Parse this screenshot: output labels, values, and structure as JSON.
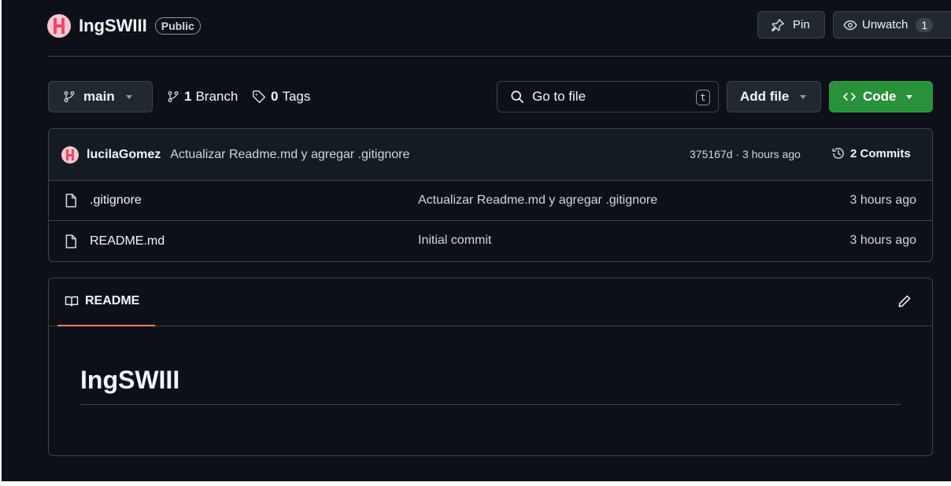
{
  "repo": {
    "name": "IngSWIII",
    "visibility": "Public"
  },
  "header": {
    "pin_label": "Pin",
    "watch_label": "Unwatch",
    "watch_count": "1"
  },
  "toolbar": {
    "branch": "main",
    "branches_count": "1",
    "branches_label": "Branch",
    "tags_count": "0",
    "tags_label": "Tags",
    "search_placeholder": "Go to file",
    "search_shortcut": "t",
    "add_file_label": "Add file",
    "code_label": "Code"
  },
  "latest_commit": {
    "author": "lucilaGomez",
    "message": "Actualizar Readme.md y agregar .gitignore",
    "meta": "375167d · 3 hours ago",
    "commits_label": "2 Commits"
  },
  "files": [
    {
      "name": ".gitignore",
      "message": "Actualizar Readme.md y agregar .gitignore",
      "time": "3 hours ago",
      "icon": "file-icon"
    },
    {
      "name": "README.md",
      "message": "Initial commit",
      "time": "3 hours ago",
      "icon": "file-icon"
    }
  ],
  "readme": {
    "tab_label": "README",
    "heading": "IngSWIII"
  },
  "colors": {
    "background": "#0d1117",
    "border": "#3d444d",
    "code_button": "#29903b",
    "tab_accent": "#f78166"
  }
}
